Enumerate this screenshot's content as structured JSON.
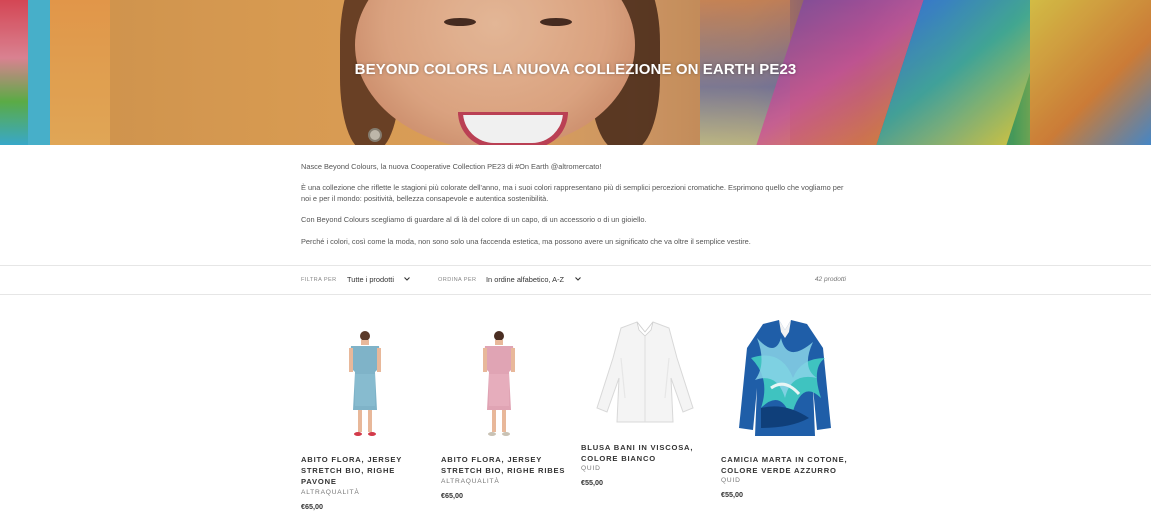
{
  "hero": {
    "title": "BEYOND COLORS LA NUOVA COLLEZIONE ON EARTH PE23"
  },
  "description": {
    "paragraphs": [
      "Nasce Beyond Colours, la nuova Cooperative Collection PE23 di #On Earth @altromercato!",
      "È una collezione che riflette le stagioni più colorate dell'anno, ma i suoi colori rappresentano più di semplici percezioni cromatiche. Esprimono quello che vogliamo per noi e per il mondo: positività, bellezza consapevole e autentica sostenibilità.",
      "Con Beyond Colours scegliamo di guardare al di là del colore di un capo, di un accessorio o di un gioiello.",
      "Perché i colori, così come la moda, non sono solo una faccenda estetica, ma possono avere un significato che va oltre il semplice vestire."
    ]
  },
  "toolbar": {
    "filter_label": "FILTRA PER",
    "filter_value": "Tutte i prodotti",
    "sort_label": "ORDINA PER",
    "sort_value": "In ordine alfabetico, A-Z",
    "product_count": "42 prodotti"
  },
  "products": [
    {
      "name": "ABITO FLORA, JERSEY STRETCH BIO, RIGHE PAVONE",
      "vendor": "ALTRAQUALITÀ",
      "price": "€65,00",
      "image": "model-teal-dress"
    },
    {
      "name": "ABITO FLORA, JERSEY STRETCH BIO, RIGHE RIBES",
      "vendor": "ALTRAQUALITÀ",
      "price": "€65,00",
      "image": "model-pink-dress"
    },
    {
      "name": "BLUSA BANI IN VISCOSA, COLORE BIANCO",
      "vendor": "QUID",
      "price": "€55,00",
      "image": "white-blouse"
    },
    {
      "name": "CAMICIA MARTA IN COTONE, COLORE VERDE AZZURRO",
      "vendor": "QUID",
      "price": "€55,00",
      "image": "patterned-blue-green-shirt"
    }
  ]
}
